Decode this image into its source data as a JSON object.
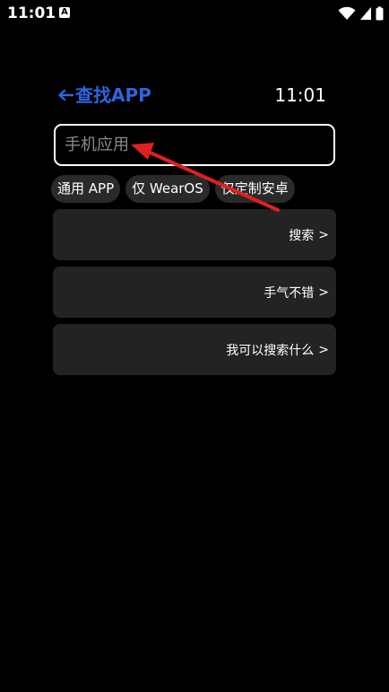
{
  "status_bar": {
    "time": "11:01",
    "notification_icon": "a-icon"
  },
  "header": {
    "title": "查找APP",
    "back_icon": "arrow-left-icon",
    "clock": "11:01"
  },
  "search": {
    "placeholder": "手机应用"
  },
  "chips": [
    {
      "label": "通用 APP"
    },
    {
      "label": "仅 WearOS"
    },
    {
      "label": "仅定制安卓"
    }
  ],
  "cards": [
    {
      "label": "搜索",
      "chevron": ">"
    },
    {
      "label": "手气不错",
      "chevron": ">"
    },
    {
      "label": "我可以搜索什么",
      "chevron": ">"
    }
  ],
  "colors": {
    "accent": "#2f64e0",
    "background": "#000000",
    "card": "#232323",
    "chip": "#2a2a2a",
    "annotation": "#e02020"
  }
}
